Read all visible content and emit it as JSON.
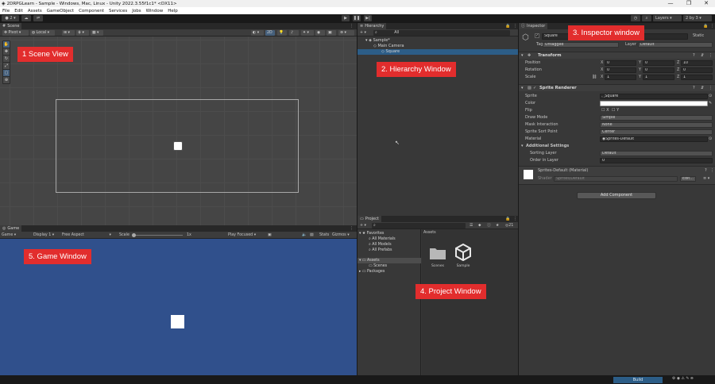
{
  "window": {
    "title": "2DRPGLearn - Sample - Windows, Mac, Linux - Unity 2022.3.55f1c1* <DX11>",
    "controls": [
      "—",
      "❐",
      "✕"
    ]
  },
  "menu": [
    "File",
    "Edit",
    "Assets",
    "GameObject",
    "Component",
    "Services",
    "Jobs",
    "Window",
    "Help"
  ],
  "toolbar": {
    "account": "2",
    "layers": "Layers",
    "layout": "2 by 3"
  },
  "scene": {
    "tab": "Scene",
    "pivot": "Pivot",
    "local": "Local",
    "mode_2d": "2D"
  },
  "game": {
    "tab": "Game",
    "mode": "Game",
    "display": "Display 1",
    "aspect": "Free Aspect",
    "scale_label": "Scale",
    "scale_value": "1x",
    "play_focused": "Play Focused",
    "stats": "Stats",
    "gizmos": "Gizmos"
  },
  "hierarchy": {
    "tab": "Hierarchy",
    "search_hint": "All",
    "rows": [
      {
        "label": "Sample*"
      },
      {
        "label": "Main Camera"
      },
      {
        "label": "Square"
      }
    ]
  },
  "project": {
    "tab": "Project",
    "counter": "21",
    "tree": [
      {
        "label": "Favorites"
      },
      {
        "label": "All Materials"
      },
      {
        "label": "All Models"
      },
      {
        "label": "All Prefabs"
      },
      {
        "label": "Assets"
      },
      {
        "label": "Scenes"
      },
      {
        "label": "Packages"
      }
    ],
    "breadcrumb": "Assets",
    "assets": [
      {
        "name": "Scenes"
      },
      {
        "name": "Sample"
      }
    ]
  },
  "inspector": {
    "tab": "Inspector",
    "object_name": "Square",
    "static": "Static",
    "tag_label": "Tag",
    "tag_value": "Untagged",
    "layer_label": "Layer",
    "layer_value": "Default",
    "transform": {
      "title": "Transform",
      "rows": [
        {
          "label": "Position",
          "x": "0",
          "y": "0",
          "z": "10"
        },
        {
          "label": "Rotation",
          "x": "0",
          "y": "0",
          "z": "0"
        },
        {
          "label": "Scale",
          "x": "1",
          "y": "1",
          "z": "1"
        }
      ]
    },
    "sprite_renderer": {
      "title": "Sprite Renderer",
      "sprite_label": "Sprite",
      "sprite_value": "Square",
      "color_label": "Color",
      "flip_label": "Flip",
      "flip_x": "X",
      "flip_y": "Y",
      "draw_mode_label": "Draw Mode",
      "draw_mode_value": "Simple",
      "mask_label": "Mask Interaction",
      "mask_value": "None",
      "sort_point_label": "Sprite Sort Point",
      "sort_point_value": "Center",
      "material_label": "Material",
      "material_value": "Sprites-Default",
      "additional": "Additional Settings",
      "sorting_layer_label": "Sorting Layer",
      "sorting_layer_value": "Default",
      "order_label": "Order in Layer",
      "order_value": "0"
    },
    "material": {
      "name": "Sprites-Default (Material)",
      "shader_label": "Shader",
      "shader_value": "Sprites/Default",
      "edit": "Edit..."
    },
    "add_component": "Add Component"
  },
  "status": {
    "build": "Build"
  },
  "annotations": [
    {
      "id": "scene",
      "text": "1 Scene View"
    },
    {
      "id": "hierarchy",
      "text": "2. Hierarchy Window"
    },
    {
      "id": "inspector",
      "text": "3. Inspector window"
    },
    {
      "id": "project",
      "text": "4. Project Window"
    },
    {
      "id": "game",
      "text": "5. Game Window"
    }
  ],
  "colors": {
    "callout": "#e22d2d",
    "selection": "#2c5d87",
    "game_bg": "#30508c"
  }
}
